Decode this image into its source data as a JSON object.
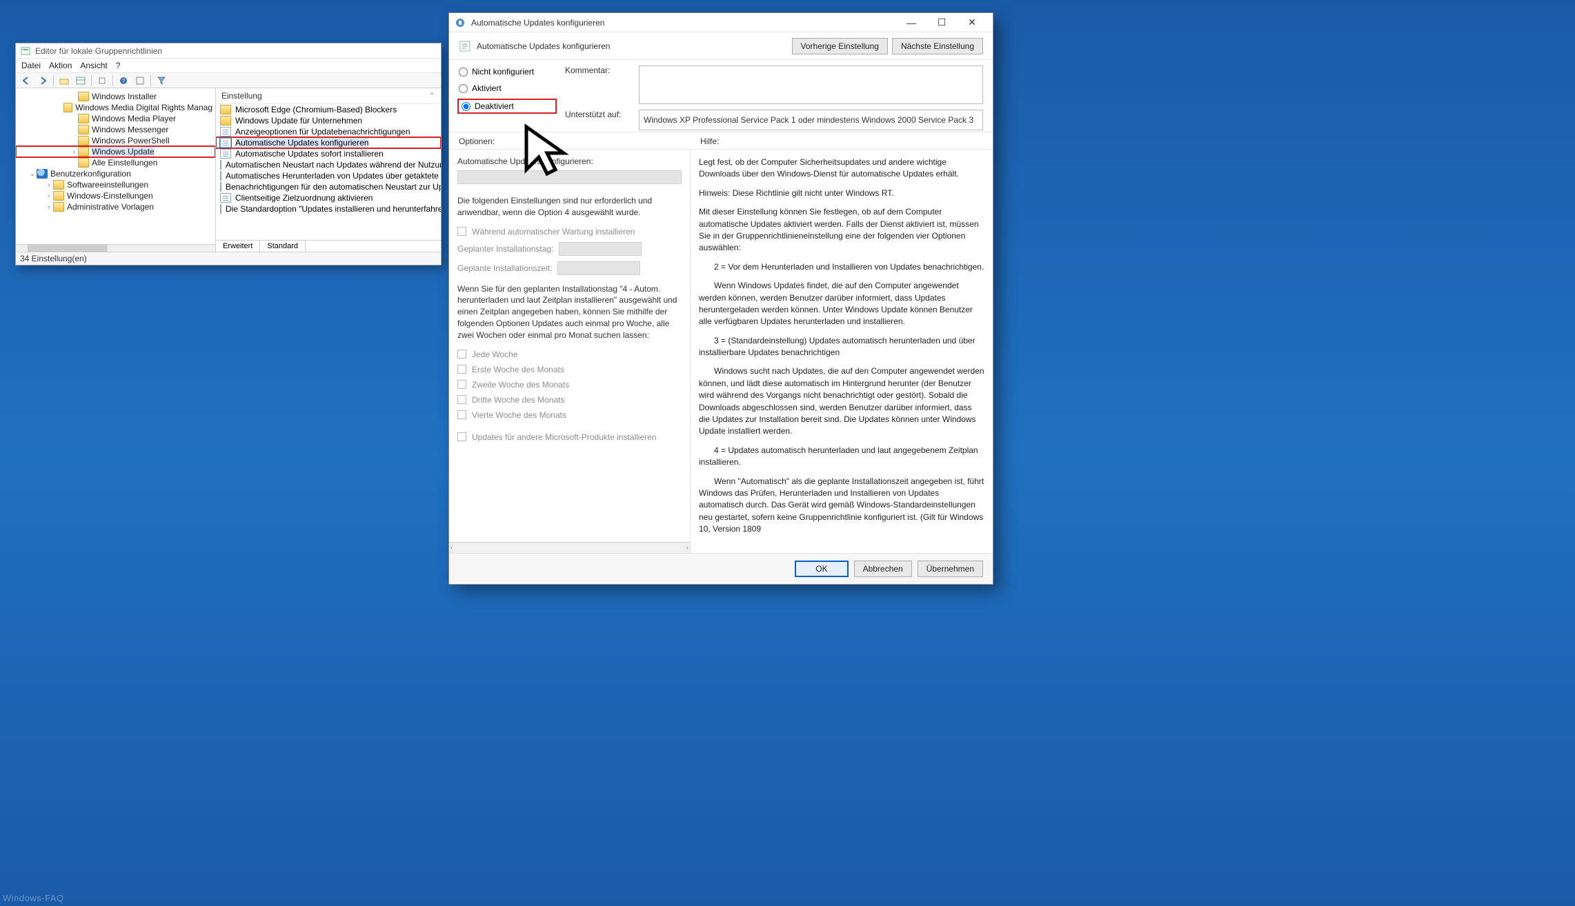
{
  "gpe": {
    "title": "Editor für lokale Gruppenrichtlinien",
    "menu": {
      "file": "Datei",
      "action": "Aktion",
      "view": "Ansicht",
      "help": "?"
    },
    "list_header": "Einstellung",
    "tree": [
      {
        "label": "Windows Installer",
        "depth": 78
      },
      {
        "label": "Windows Media Digital Rights Manag",
        "depth": 78
      },
      {
        "label": "Windows Media Player",
        "depth": 78
      },
      {
        "label": "Windows Messenger",
        "depth": 78
      },
      {
        "label": "Windows PowerShell",
        "depth": 78
      },
      {
        "label": "Windows Update",
        "depth": 78,
        "chev": ">",
        "selected": true,
        "highlight": true
      },
      {
        "label": "Alle Einstellungen",
        "depth": 78
      },
      {
        "label": "Benutzerkonfiguration",
        "depth": 18,
        "chev": "v",
        "icon": "user"
      },
      {
        "label": "Softwareeinstellungen",
        "depth": 42,
        "chev": ">"
      },
      {
        "label": "Windows-Einstellungen",
        "depth": 42,
        "chev": ">"
      },
      {
        "label": "Administrative Vorlagen",
        "depth": 42,
        "chev": ">"
      }
    ],
    "settings": [
      {
        "label": "Microsoft Edge (Chromium-Based) Blockers",
        "kind": "folder"
      },
      {
        "label": "Windows Update für Unternehmen",
        "kind": "folder"
      },
      {
        "label": "Anzeigeoptionen für Updatebenachrichtigungen",
        "kind": "doc"
      },
      {
        "label": "Automatische Updates konfigurieren",
        "kind": "doc",
        "selected": true,
        "highlight": true
      },
      {
        "label": "Automatische Updates sofort installieren",
        "kind": "doc"
      },
      {
        "label": "Automatischen Neustart nach Updates während der Nutzun",
        "kind": "doc"
      },
      {
        "label": "Automatisches Herunterladen von Updates über getaktete V",
        "kind": "doc"
      },
      {
        "label": "Benachrichtigungen für den automatischen Neustart zur Up",
        "kind": "doc"
      },
      {
        "label": "Clientseitige Zielzuordnung aktivieren",
        "kind": "doc"
      },
      {
        "label": "Die Standardoption \"Updates installieren und herunterfahren",
        "kind": "doc"
      }
    ],
    "tabs": {
      "extended": "Erweitert",
      "standard": "Standard"
    },
    "status": "34 Einstellung(en)"
  },
  "policy": {
    "title": "Automatische Updates konfigurieren",
    "subtitle": "Automatische Updates konfigurieren",
    "prev_btn": "Vorherige Einstellung",
    "next_btn": "Nächste Einstellung",
    "radios": {
      "not_configured": "Nicht konfiguriert",
      "enabled": "Aktiviert",
      "disabled": "Deaktiviert"
    },
    "comment_label": "Kommentar:",
    "supported_label": "Unterstützt auf:",
    "supported_text": "Windows XP Professional Service Pack 1 oder mindestens Windows 2000 Service Pack 3",
    "options_label": "Optionen:",
    "help_label": "Hilfe:",
    "opts": {
      "header": "Automatische Updates konfigurieren:",
      "note": "Die folgenden Einstellungen sind nur erforderlich und anwendbar, wenn die Option 4 ausgewählt wurde.",
      "maint": "Während automatischer Wartung installieren",
      "day_label": "Geplanter Installationstag:",
      "time_label": "Geplante Installationszeit:",
      "para": "Wenn Sie für den geplanten Installationstag \"4 - Autom. herunterladen und laut Zeitplan installieren\" ausgewählt und einen Zeitplan angegeben haben, können Sie mithilfe der folgenden Optionen Updates auch einmal pro Woche, alle zwei Wochen oder einmal pro Monat suchen lassen:",
      "w1": "Jede Woche",
      "w2": "Erste Woche des Monats",
      "w3": "Zweite Woche des Monats",
      "w4": "Dritte Woche des Monats",
      "w5": "Vierte Woche des Monats",
      "ms": "Updates für andere Microsoft-Produkte installieren"
    },
    "help": {
      "p1": "Legt fest, ob der Computer Sicherheitsupdates und andere wichtige Downloads über den Windows-Dienst für automatische Updates erhält.",
      "p2": "Hinweis: Diese Richtlinie gilt nicht unter Windows RT.",
      "p3": "Mit dieser Einstellung können Sie festlegen, ob auf dem Computer automatische Updates aktiviert werden. Falls der Dienst aktiviert ist, müssen Sie in der Gruppenrichtlinieneinstellung eine der folgenden vier Optionen auswählen:",
      "p4": "2 = Vor dem Herunterladen und Installieren von Updates benachrichtigen.",
      "p5": "Wenn Windows Updates findet, die auf den Computer angewendet werden können, werden Benutzer darüber informiert, dass Updates heruntergeladen werden können. Unter Windows Update können Benutzer alle verfügbaren Updates herunterladen und installieren.",
      "p6": "3 = (Standardeinstellung) Updates automatisch herunterladen und über installierbare Updates benachrichtigen",
      "p7": "Windows sucht nach Updates, die auf den Computer angewendet werden können, und lädt diese automatisch im Hintergrund herunter (der Benutzer wird während des Vorgangs nicht benachrichtigt oder gestört). Sobald die Downloads abgeschlossen sind, werden Benutzer darüber informiert, dass die Updates zur Installation bereit sind. Die Updates können unter Windows Update installiert werden.",
      "p8": "4 = Updates automatisch herunterladen und laut angegebenem Zeitplan installieren.",
      "p9": "Wenn \"Automatisch\" als die geplante Installationszeit angegeben ist, führt Windows das Prüfen, Herunterladen und Installieren von Updates automatisch durch. Das Gerät wird gemäß Windows-Standardeinstellungen neu gestartet, sofern keine Gruppenrichtlinie konfiguriert ist. (Gilt für Windows 10, Version 1809"
    },
    "footer": {
      "ok": "OK",
      "cancel": "Abbrechen",
      "apply": "Übernehmen"
    }
  },
  "watermark": "Windows-FAQ"
}
